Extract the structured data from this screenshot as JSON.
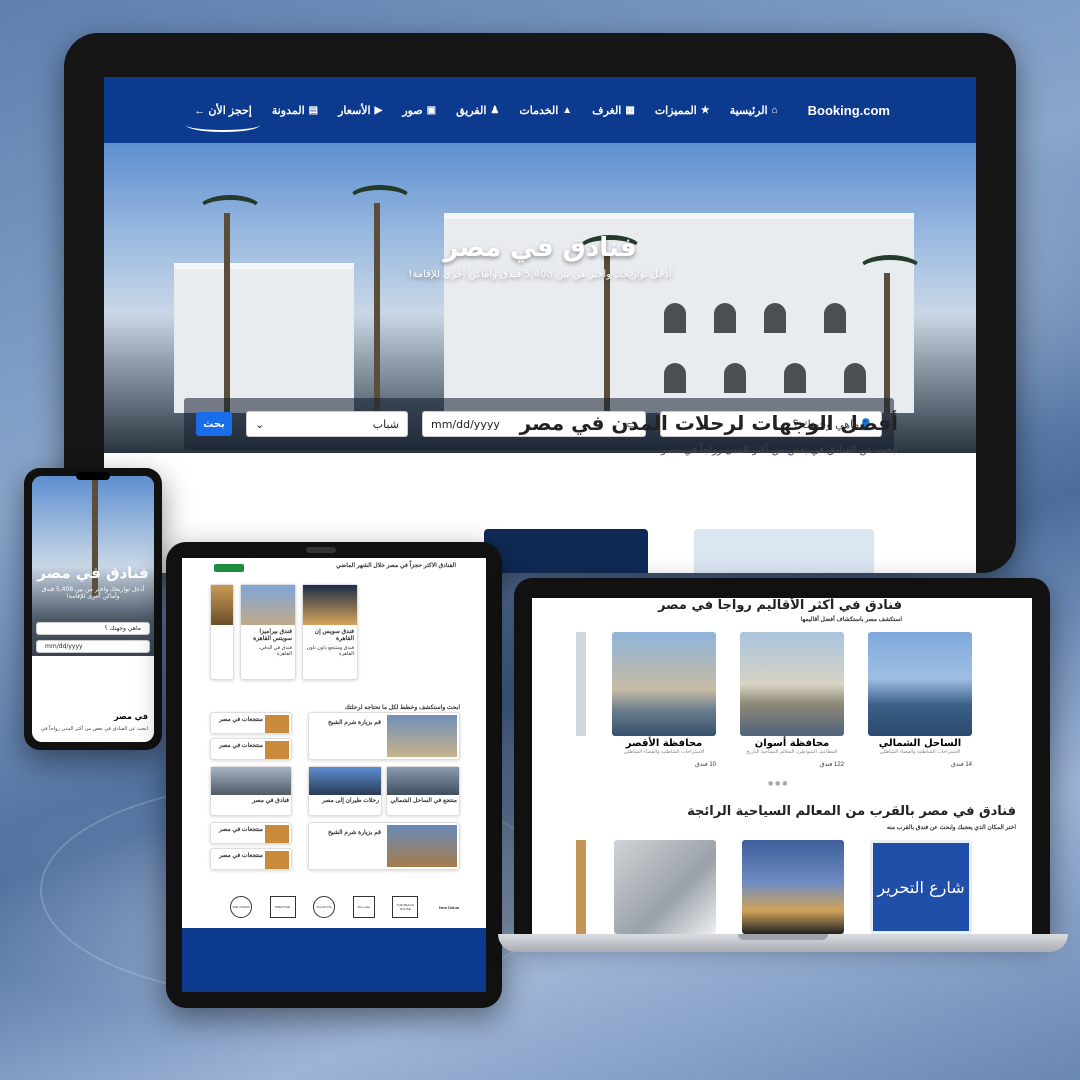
{
  "monitor": {
    "nav": {
      "brand": "Booking.com",
      "items": [
        {
          "label": "الرئيسية",
          "icon": "home-icon"
        },
        {
          "label": "المميزات",
          "icon": "star-icon"
        },
        {
          "label": "الغرف",
          "icon": "building-icon"
        },
        {
          "label": "الخدمات",
          "icon": "bell-icon"
        },
        {
          "label": "الفريق",
          "icon": "team-icon"
        },
        {
          "label": "صور",
          "icon": "image-icon"
        },
        {
          "label": "الأسعار",
          "icon": "video-icon"
        },
        {
          "label": "المدونة",
          "icon": "blog-icon"
        }
      ],
      "cta": "إحجز الأن ←"
    },
    "hero": {
      "title": "فنادق في مصر",
      "subtitle": "أدخل تواريخك واختر من بين 5,408 فندق وأماكن أخرى للإقامة!",
      "search": {
        "destination_placeholder": "ماهي وجهتك ؟",
        "date_placeholder": "mm/dd/yyyy",
        "guests_value": "شباب",
        "button": "بحث"
      }
    },
    "section": {
      "title": "أفضل الوجهات لرحلات المدن في مصر",
      "subtitle": "ابحث عن الفنادق في بعض من أكثر المدن رواجاً في مصر"
    }
  },
  "phone": {
    "title": "فنادق في مصر",
    "subtitle": "أدخل تواريخك واختر من بين 5,408 فندق وأماكن أخرى للإقامة!",
    "destination_placeholder": "ماهي وجهتك ؟",
    "date_placeholder": "mm/dd/yyyy",
    "section_title": "في مصر",
    "section_subtitle": "ابحث عن الفنادق في بعض من أكثر المدن رواجاً في"
  },
  "tablet": {
    "top_title": "الفنادق الاكثر حجزاً في مصر خلال الشهر الماضي",
    "hotels": [
      {
        "name": "فندق سويس إن القاهرة",
        "desc": "فندق ومنتجع داون تاون القاهرة"
      },
      {
        "name": "فندق بيراميزا سويتس القاهرة",
        "desc": "فندق في الدقي، القاهرة"
      }
    ],
    "plan_title": "ابحث واستكشف وخطط لكل ما تحتاجه لرحلتك",
    "articles": [
      {
        "title": "قم بزيارة شرم الشيخ"
      },
      {
        "title": "منتجعات في مصر"
      },
      {
        "title": "منتجع في الساحل الشمالي"
      },
      {
        "title": "رحلات طيران إلى مصر"
      },
      {
        "title": "فنادق في مصر"
      },
      {
        "title": "قم بزيارة شرم الشيخ"
      },
      {
        "title": "منتجعات في مصر"
      }
    ],
    "logos": [
      "THE OCEAN",
      "PRESTIGE",
      "The ROYAL",
      "The Lake",
      "THE BEACH HOUSE",
      "New Dahia"
    ]
  },
  "laptop": {
    "region_title": "فنادق في أكثر الأقاليم رواجاً في مصر",
    "region_subtitle": "استكشف مصر باستكشاف أفضل أقاليمها",
    "regions": [
      {
        "name": "الساحل الشمالي",
        "desc": "الاستراحات الشاطئية والقضاء الشاطئي",
        "count": "14 فندق"
      },
      {
        "name": "محافظة أسوان",
        "desc": "المطاعم، الشواطئ، المعالم السياحية التاريخ",
        "count": "122 فندق"
      },
      {
        "name": "محافظة الأقصر",
        "desc": "الاستراحات الشاطئية والقضاء الشاطئي",
        "count": "10 فندق"
      }
    ],
    "landmark_title": "فنادق في مصر بالقرب من المعالم السياحية الرائجة",
    "landmark_subtitle": "اختر المكان الذي يعجبك وابحث عن فندق بالقرب منه",
    "sign_text": "شارع التحرير"
  },
  "colors": {
    "brand": "#0b3a8f",
    "accent": "#1a6dea"
  }
}
